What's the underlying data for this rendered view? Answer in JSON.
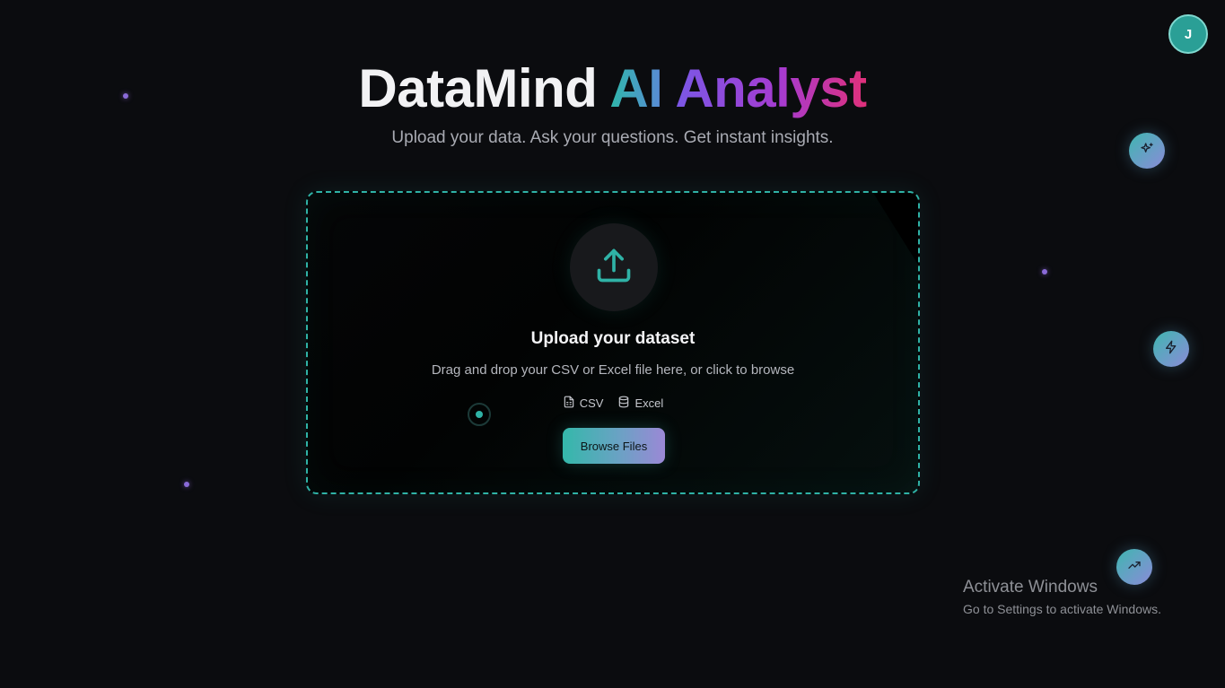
{
  "header": {
    "title_part1": "DataMind",
    "title_part2": "AI",
    "title_part3": "Analyst",
    "subtitle": "Upload your data. Ask your questions. Get instant insights."
  },
  "user": {
    "avatar_initial": "J"
  },
  "upload": {
    "icon": "upload-icon",
    "heading": "Upload your dataset",
    "description": "Drag and drop your CSV or Excel file here, or click to browse",
    "formats": [
      {
        "label": "CSV",
        "icon": "file-spreadsheet-icon"
      },
      {
        "label": "Excel",
        "icon": "database-icon"
      }
    ],
    "browse_label": "Browse Files"
  },
  "floating_icons": [
    "sparkles-icon",
    "zap-icon",
    "trending-up-icon"
  ],
  "watermark": {
    "title": "Activate Windows",
    "subtitle": "Go to Settings to activate Windows."
  },
  "colors": {
    "background": "#0b0c0f",
    "accent_teal": "#2fb2a6",
    "accent_purple": "#7a58e6",
    "accent_pink": "#e0307a"
  }
}
